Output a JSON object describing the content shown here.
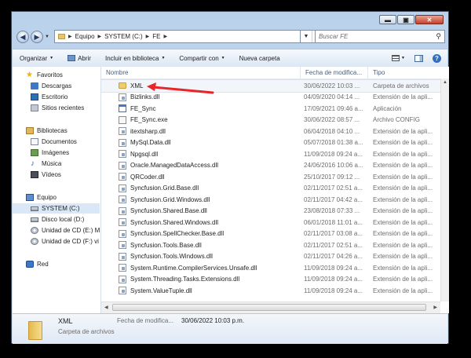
{
  "window": {
    "buttons": [
      "▬",
      "▣",
      "✕"
    ]
  },
  "address": {
    "crumbs": [
      "Equipo",
      "SYSTEM (C:)",
      "FE"
    ],
    "search_placeholder": "Buscar FE"
  },
  "toolbar": {
    "organize": "Organizar",
    "open": "Abrir",
    "include": "Incluir en biblioteca",
    "share": "Compartir con",
    "new_folder": "Nueva carpeta"
  },
  "nav": {
    "favorites": "Favoritos",
    "downloads": "Descargas",
    "desktop": "Escritorio",
    "recent": "Sitios recientes",
    "libraries": "Bibliotecas",
    "documents": "Documentos",
    "images": "Imágenes",
    "music": "Música",
    "videos": "Vídeos",
    "computer": "Equipo",
    "system": "SYSTEM (C:)",
    "local_d": "Disco local (D:)",
    "cd_e": "Unidad de CD (E:) M",
    "cd_f": "Unidad de CD (F:) vi",
    "network": "Red"
  },
  "columns": {
    "name": "Nombre",
    "date": "Fecha de modifica...",
    "type": "Tipo"
  },
  "files": [
    {
      "name": "XML",
      "date": "30/06/2022 10:03 ...",
      "type": "Carpeta de archivos",
      "icon": "folder-icon"
    },
    {
      "name": "Bizlinks.dll",
      "date": "04/09/2020 04:14 ...",
      "type": "Extensión de la apli...",
      "icon": "dll-icon"
    },
    {
      "name": "FE_Sync",
      "date": "17/09/2021 09:46 a...",
      "type": "Aplicación",
      "icon": "application-icon"
    },
    {
      "name": "FE_Sync.exe",
      "date": "30/06/2022 08:57 ...",
      "type": "Archivo CONFIG",
      "icon": "config-icon"
    },
    {
      "name": "itextsharp.dll",
      "date": "06/04/2018 04:10 ...",
      "type": "Extensión de la apli...",
      "icon": "dll-icon"
    },
    {
      "name": "MySql.Data.dll",
      "date": "05/07/2018 01:38 a...",
      "type": "Extensión de la apli...",
      "icon": "dll-icon"
    },
    {
      "name": "Npgsql.dll",
      "date": "11/09/2018 09:24 a...",
      "type": "Extensión de la apli...",
      "icon": "dll-icon"
    },
    {
      "name": "Oracle.ManagedDataAccess.dll",
      "date": "24/06/2016 10:06 a...",
      "type": "Extensión de la apli...",
      "icon": "dll-icon"
    },
    {
      "name": "QRCoder.dll",
      "date": "25/10/2017 09:12 ...",
      "type": "Extensión de la apli...",
      "icon": "dll-icon"
    },
    {
      "name": "Syncfusion.Grid.Base.dll",
      "date": "02/11/2017 02:51 a...",
      "type": "Extensión de la apli...",
      "icon": "dll-icon"
    },
    {
      "name": "Syncfusion.Grid.Windows.dll",
      "date": "02/11/2017 04:42 a...",
      "type": "Extensión de la apli...",
      "icon": "dll-icon"
    },
    {
      "name": "Syncfusion.Shared.Base.dll",
      "date": "23/08/2018 07:33 ...",
      "type": "Extensión de la apli...",
      "icon": "dll-icon"
    },
    {
      "name": "Syncfusion.Shared.Windows.dll",
      "date": "06/01/2018 11:01 a...",
      "type": "Extensión de la apli...",
      "icon": "dll-icon"
    },
    {
      "name": "Syncfusion.SpellChecker.Base.dll",
      "date": "02/11/2017 03:08 a...",
      "type": "Extensión de la apli...",
      "icon": "dll-icon"
    },
    {
      "name": "Syncfusion.Tools.Base.dll",
      "date": "02/11/2017 02:51 a...",
      "type": "Extensión de la apli...",
      "icon": "dll-icon"
    },
    {
      "name": "Syncfusion.Tools.Windows.dll",
      "date": "02/11/2017 04:26 a...",
      "type": "Extensión de la apli...",
      "icon": "dll-icon"
    },
    {
      "name": "System.Runtime.CompilerServices.Unsafe.dll",
      "date": "11/09/2018 09:24 a...",
      "type": "Extensión de la apli...",
      "icon": "dll-icon"
    },
    {
      "name": "System.Threading.Tasks.Extensions.dll",
      "date": "11/09/2018 09:24 a...",
      "type": "Extensión de la apli...",
      "icon": "dll-icon"
    },
    {
      "name": "System.ValueTuple.dll",
      "date": "11/09/2018 09:24 a...",
      "type": "Extensión de la apli...",
      "icon": "dll-icon"
    }
  ],
  "details": {
    "name": "XML",
    "type": "Carpeta de archivos",
    "date_label": "Fecha de modifica...",
    "date_value": "30/06/2022 10:03 p.m."
  },
  "annotation_color": "#e8262a"
}
